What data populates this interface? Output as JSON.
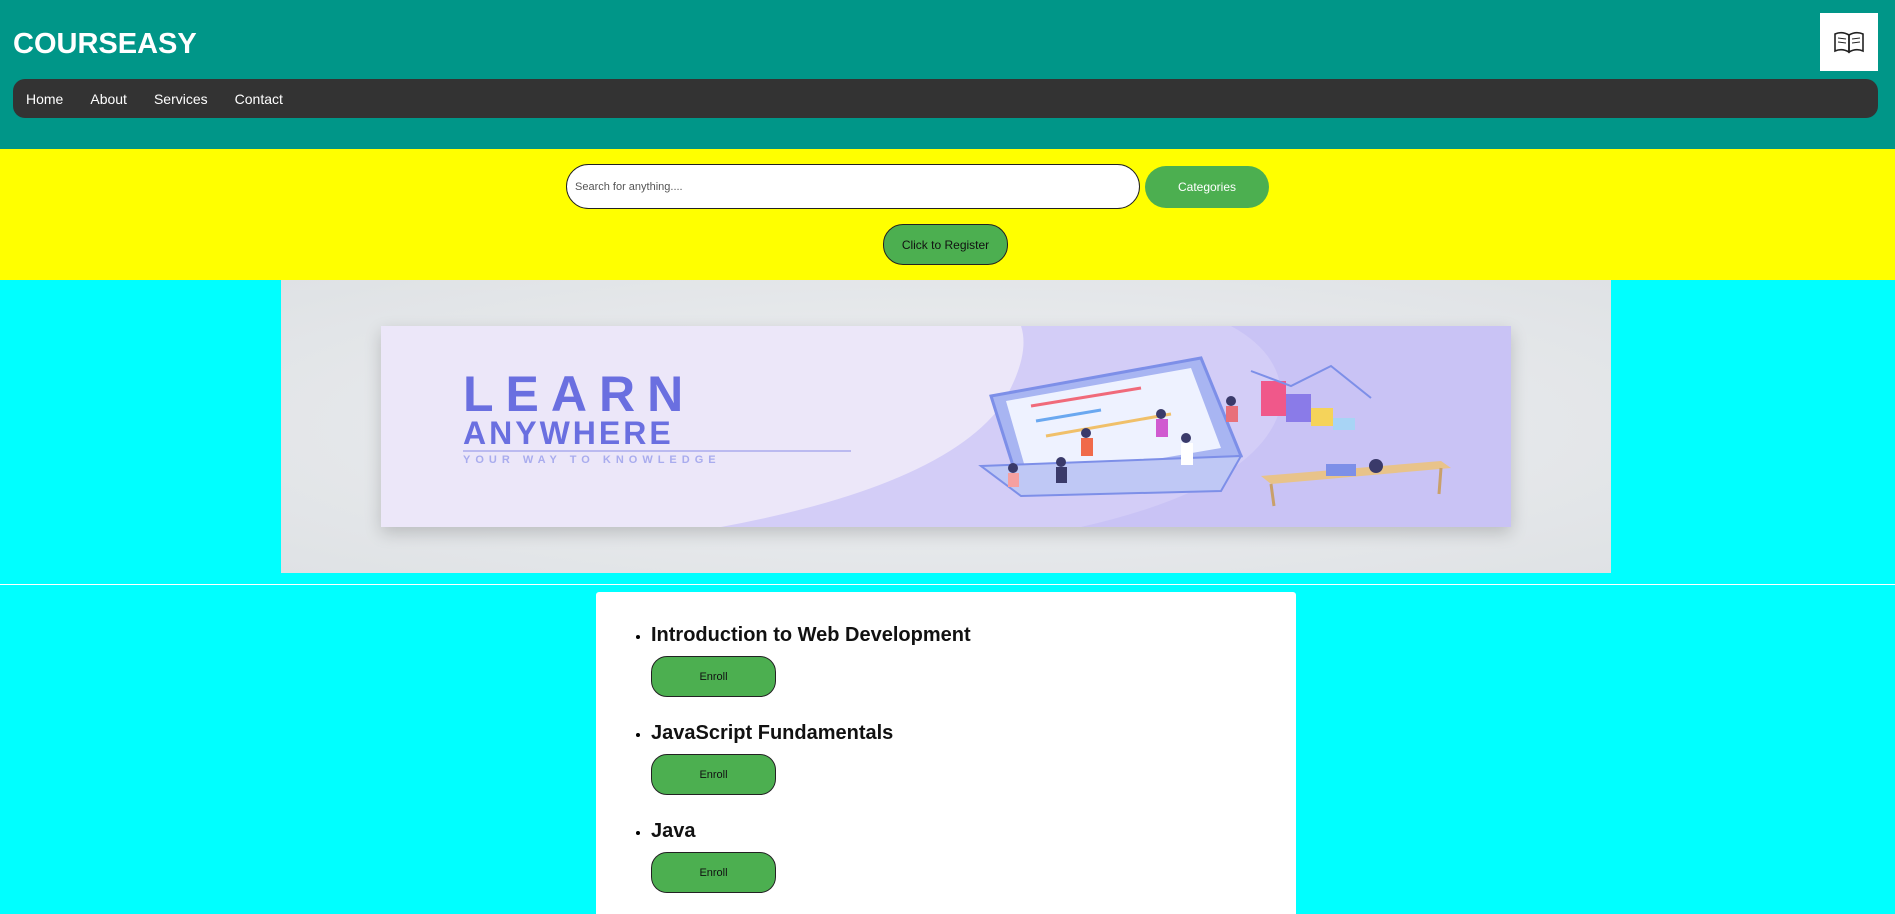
{
  "header": {
    "brand": "COURSEASY",
    "logo_icon": "open-book-icon",
    "bg_color": "#009688"
  },
  "nav": {
    "items": [
      {
        "label": "Home"
      },
      {
        "label": "About"
      },
      {
        "label": "Services"
      },
      {
        "label": "Contact"
      }
    ]
  },
  "search": {
    "placeholder": "Search for anything....",
    "value": "",
    "categories_label": "Categories",
    "register_label": "Click to Register"
  },
  "banner": {
    "headline": "LEARN",
    "subheadline": "ANYWHERE",
    "tagline": "YOUR WAY TO KNOWLEDGE"
  },
  "courses": [
    {
      "title": "Introduction to Web Development",
      "button": "Enroll"
    },
    {
      "title": "JavaScript Fundamentals",
      "button": "Enroll"
    },
    {
      "title": "Java",
      "button": "Enroll"
    }
  ],
  "colors": {
    "page_bg": "#00ffff",
    "search_band": "#ffff00",
    "nav_bg": "#333333",
    "button_green": "#4caf50"
  }
}
